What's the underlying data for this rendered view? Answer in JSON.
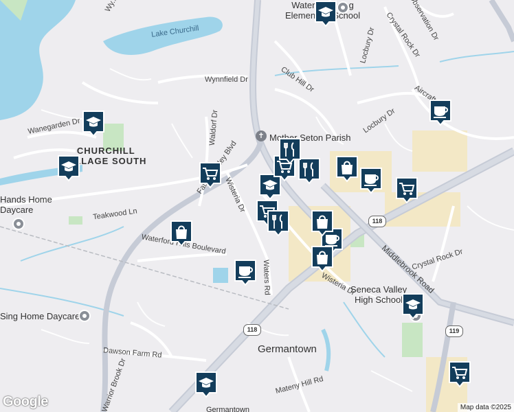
{
  "map": {
    "attribution": "Map data ©2025",
    "logo_text": "Google",
    "colors": {
      "land": "#eeedf0",
      "water": "#9fd4ea",
      "park": "#c8e6c3",
      "commercial": "#f3e8c6",
      "road": "#ffffff",
      "highway": "#c6cbd6",
      "pin": "#133d5b",
      "pin_border": "#ffffff"
    }
  },
  "labels": {
    "places": [
      {
        "id": "waters-landing",
        "text": "Waters Landing\nElementary School"
      },
      {
        "id": "lake-churchill",
        "text": "Lake Churchill"
      },
      {
        "id": "churchill-village-south",
        "text": "CHURCHILL\nVILLAGE SOUTH"
      },
      {
        "id": "daycare-1",
        "text": "Hands Home\nDaycare"
      },
      {
        "id": "daycare-2",
        "text": "Sing Home Daycare"
      },
      {
        "id": "seton-parish",
        "text": "Mother Seton Parish"
      },
      {
        "id": "seneca-valley",
        "text": "Seneca Valley\nHigh School"
      },
      {
        "id": "germantown",
        "text": "Germantown"
      },
      {
        "id": "germantown-bottom",
        "text": "Germantown"
      }
    ],
    "streets": [
      {
        "id": "locbury-dr-1",
        "text": "Locbury Dr"
      },
      {
        "id": "locbury-dr-2",
        "text": "Locbury Dr"
      },
      {
        "id": "crystal-rock-dr-1",
        "text": "Crystal Rock Dr"
      },
      {
        "id": "crystal-rock-dr-2",
        "text": "Crystal Rock Dr"
      },
      {
        "id": "club-hill-dr",
        "text": "Club Hill Dr"
      },
      {
        "id": "wynnfield-dr",
        "text": "Wynnfield Dr"
      },
      {
        "id": "wanegarden-dr",
        "text": "Wanegarden Dr"
      },
      {
        "id": "waldorf-dr",
        "text": "Waldorf Dr"
      },
      {
        "id": "father-hurley-blvd",
        "text": "Father Hurley Blvd"
      },
      {
        "id": "wisteria-dr-1",
        "text": "Wisteria Dr"
      },
      {
        "id": "wisteria-dr-2",
        "text": "Wisteria Dr"
      },
      {
        "id": "teakwood-ln",
        "text": "Teakwood Ln"
      },
      {
        "id": "waterford-hills-blvd",
        "text": "Waterford Hills Boulevard"
      },
      {
        "id": "waters-rd",
        "text": "Waters Rd"
      },
      {
        "id": "middlebrook-rd",
        "text": "Middlebrook Road"
      },
      {
        "id": "aircraft-dr",
        "text": "Aircraft Dr"
      },
      {
        "id": "dawson-farm-rd",
        "text": "Dawson Farm Rd"
      },
      {
        "id": "warrior-brook-dr",
        "text": "Warrior Brook Dr"
      },
      {
        "id": "mateny-hill-rd",
        "text": "Mateny Hill Rd"
      },
      {
        "id": "observation-dr",
        "text": "Observation Dr"
      },
      {
        "id": "wynd-dr",
        "text": "Wy..."
      }
    ],
    "shields": [
      {
        "id": "shield-118-a",
        "text": "118"
      },
      {
        "id": "shield-118-b",
        "text": "118"
      },
      {
        "id": "shield-119",
        "text": "119"
      }
    ]
  },
  "pins": [
    {
      "id": "pin-school-waters",
      "icon": "school"
    },
    {
      "id": "pin-school-churchill",
      "icon": "school"
    },
    {
      "id": "pin-school-west",
      "icon": "school"
    },
    {
      "id": "pin-school-seneca",
      "icon": "school"
    },
    {
      "id": "pin-school-south",
      "icon": "school"
    },
    {
      "id": "pin-school-center",
      "icon": "school"
    },
    {
      "id": "pin-cafe-aircraft",
      "icon": "cafe"
    },
    {
      "id": "pin-cafe-waters-rd",
      "icon": "cafe"
    },
    {
      "id": "pin-cafe-center",
      "icon": "cafe"
    },
    {
      "id": "pin-cafe-center-2",
      "icon": "cafe"
    },
    {
      "id": "pin-grocery-blvd",
      "icon": "grocery"
    },
    {
      "id": "pin-grocery-center",
      "icon": "grocery"
    },
    {
      "id": "pin-grocery-east",
      "icon": "grocery"
    },
    {
      "id": "pin-grocery-se",
      "icon": "grocery"
    },
    {
      "id": "pin-grocery-center-2",
      "icon": "grocery"
    },
    {
      "id": "pin-shopping-waterford",
      "icon": "shopping"
    },
    {
      "id": "pin-shopping-center",
      "icon": "shopping"
    },
    {
      "id": "pin-shopping-center-2",
      "icon": "shopping"
    },
    {
      "id": "pin-shopping-center-3",
      "icon": "shopping"
    },
    {
      "id": "pin-restaurant-center",
      "icon": "restaurant"
    },
    {
      "id": "pin-restaurant-center-2",
      "icon": "restaurant"
    },
    {
      "id": "pin-restaurant-center-3",
      "icon": "restaurant"
    }
  ]
}
